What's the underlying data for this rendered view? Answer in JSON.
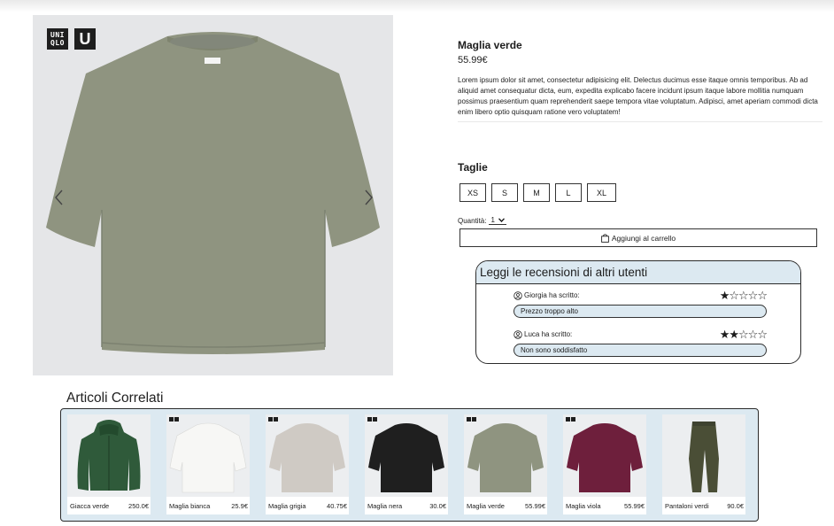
{
  "brand": {
    "logo_top": "UNI",
    "logo_bottom": "QLO",
    "logo_u": "U"
  },
  "product": {
    "name": "Maglia verde",
    "price": "55.99€",
    "description": "Lorem ipsum dolor sit amet, consectetur adipisicing elit. Delectus ducimus esse itaque omnis temporibus. Ab ad aliquid amet consequatur dicta, eum, expedita explicabo facere incidunt ipsum itaque labore mollitia numquam possimus praesentium quam reprehenderit saepe tempora vitae voluptatum. Adipisci, amet aperiam commodi dicta enim libero optio quisquam ratione vero voluptatem!",
    "color": "#8f9480"
  },
  "sizes": {
    "title": "Taglie",
    "options": [
      "XS",
      "S",
      "M",
      "L",
      "XL"
    ]
  },
  "quantity": {
    "label": "Quantità:",
    "value": "1"
  },
  "cart": {
    "label": "Aggiungi al carrello"
  },
  "reviews": {
    "title": "Leggi le recensioni di altri utenti",
    "items": [
      {
        "author": "Giorgia ha scritto:",
        "rating": 1,
        "text": "Prezzo troppo alto"
      },
      {
        "author": "Luca ha scritto:",
        "rating": 2,
        "text": "Non sono soddisfatto"
      }
    ]
  },
  "related": {
    "title": "Articoli Correlati",
    "items": [
      {
        "name": "Giacca verde",
        "price": "250.0€",
        "kind": "jacket",
        "color": "#2f5a3a",
        "logo": false
      },
      {
        "name": "Maglia bianca",
        "price": "25.9€",
        "kind": "tee",
        "color": "#f7f7f5",
        "logo": true
      },
      {
        "name": "Maglia grigia",
        "price": "40.75€",
        "kind": "tee",
        "color": "#cfcac4",
        "logo": true
      },
      {
        "name": "Maglia nera",
        "price": "30.0€",
        "kind": "tee",
        "color": "#1f1f1f",
        "logo": true
      },
      {
        "name": "Maglia verde",
        "price": "55.99€",
        "kind": "tee",
        "color": "#8f9480",
        "logo": true
      },
      {
        "name": "Maglia viola",
        "price": "55.99€",
        "kind": "tee",
        "color": "#6e1f3c",
        "logo": true
      },
      {
        "name": "Pantaloni verdi",
        "price": "90.0€",
        "kind": "pants",
        "color": "#4a4e36",
        "logo": false
      }
    ]
  },
  "colors": {
    "accent_bg": "#dce9f1",
    "border": "#2b2b2b"
  }
}
